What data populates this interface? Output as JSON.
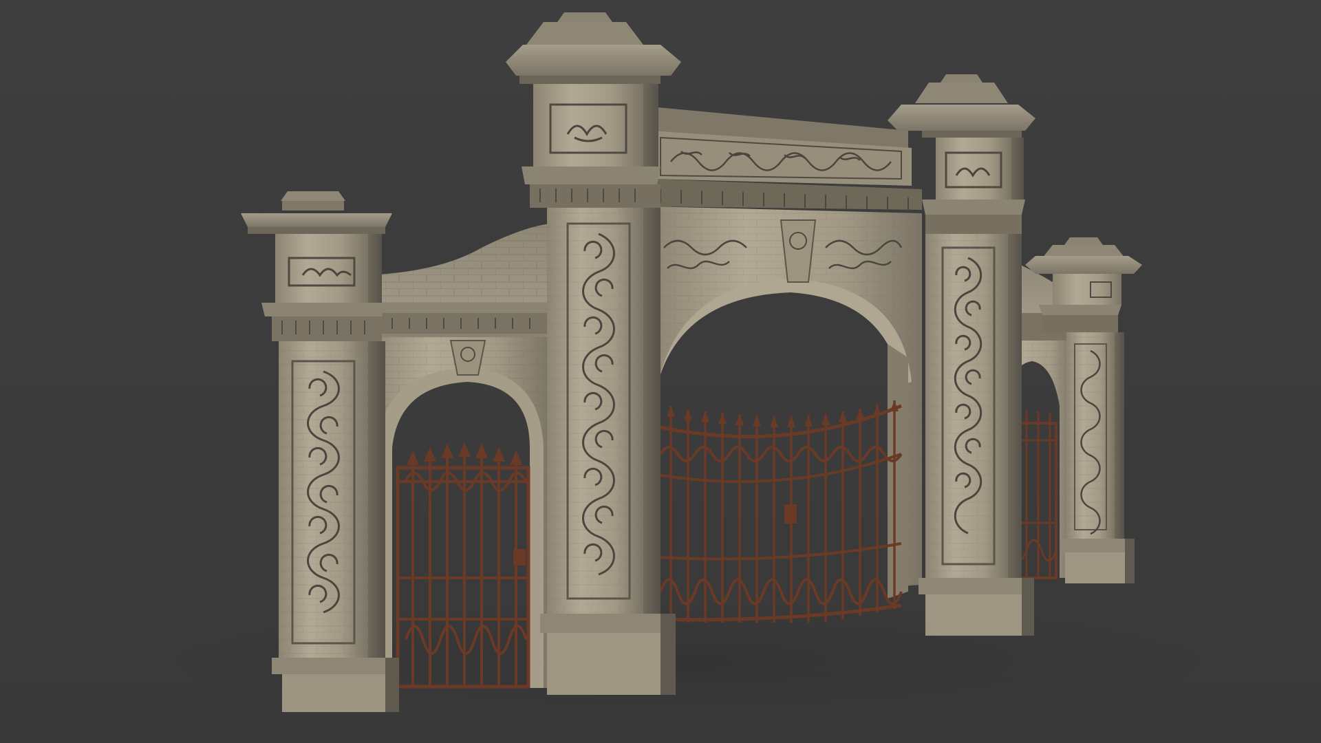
{
  "scene": {
    "background": "#3c3c3c",
    "subject": "stone-gate-with-iron-gates",
    "colors": {
      "stone_light": "#b3aa97",
      "stone_mid": "#8f8775",
      "stone_dark": "#5f5a4f",
      "stone_shadow": "#3f3c36",
      "iron_rust": "#6b3a26",
      "carving": "#4a463d"
    }
  }
}
